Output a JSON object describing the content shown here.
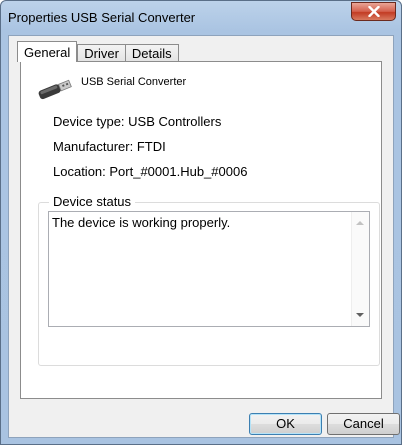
{
  "window": {
    "title": "Properties USB Serial Converter",
    "close_icon": "close-icon"
  },
  "tabs": [
    {
      "label": "General",
      "active": true
    },
    {
      "label": "Driver",
      "active": false
    },
    {
      "label": "Details",
      "active": false
    }
  ],
  "device": {
    "icon": "usb-device-icon",
    "name": "USB Serial Converter",
    "type_line": "Device type: USB Controllers",
    "manufacturer_line": "Manufacturer: FTDI",
    "location_line": "Location: Port_#0001.Hub_#0006"
  },
  "status": {
    "legend": "Device status",
    "text": "The device is working properly."
  },
  "buttons": {
    "ok": "OK",
    "cancel": "Cancel"
  }
}
